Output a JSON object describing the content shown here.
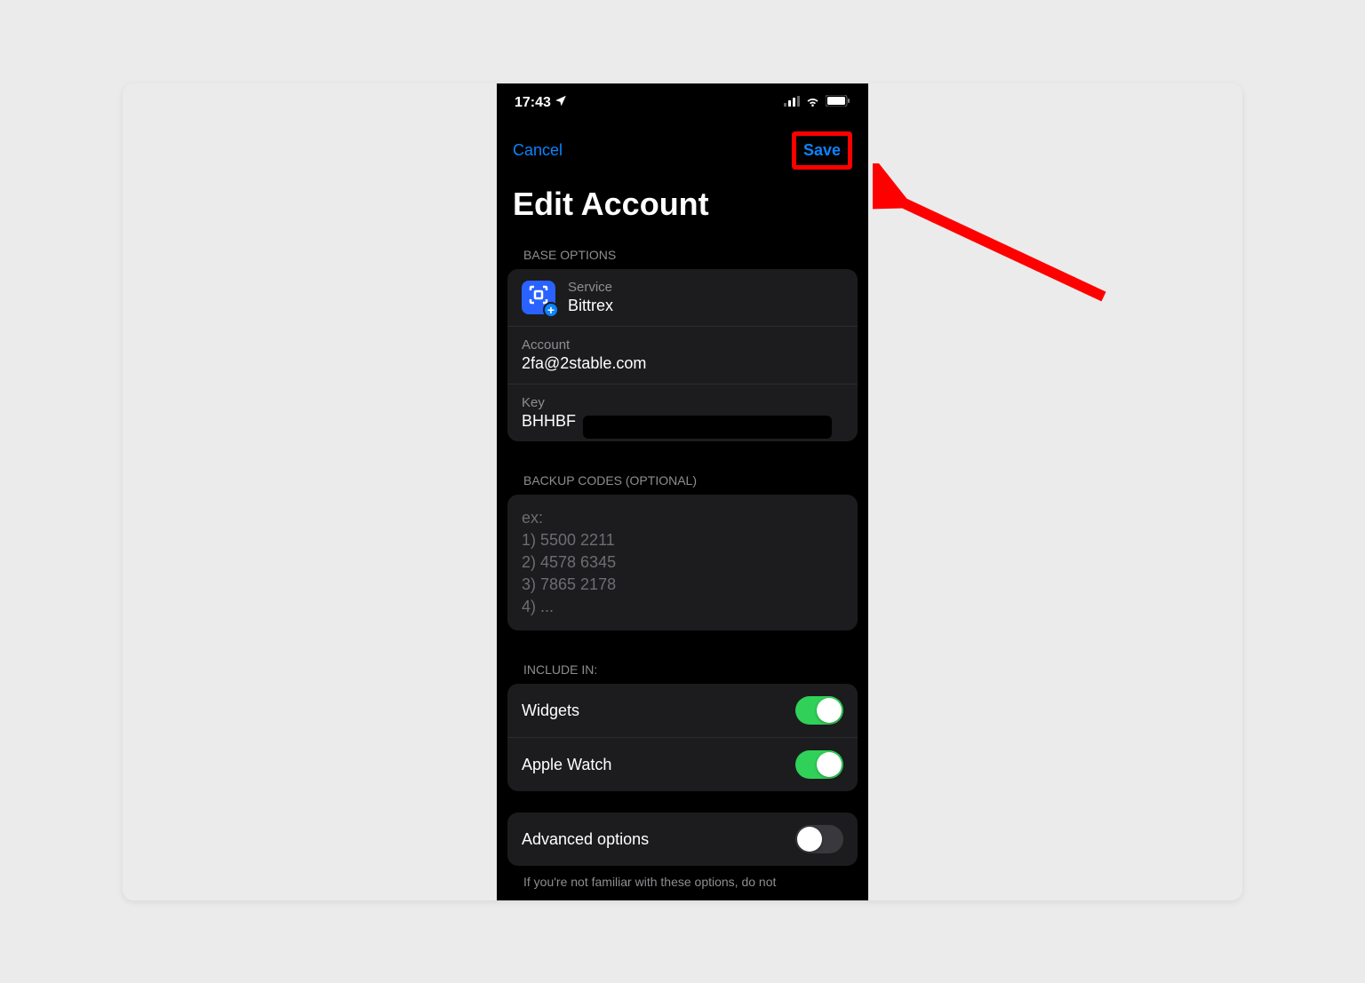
{
  "statusBar": {
    "time": "17:43"
  },
  "nav": {
    "cancel": "Cancel",
    "save": "Save"
  },
  "title": "Edit Account",
  "sections": {
    "baseOptions": {
      "header": "BASE OPTIONS",
      "service": {
        "label": "Service",
        "value": "Bittrex"
      },
      "account": {
        "label": "Account",
        "value": "2fa@2stable.com"
      },
      "key": {
        "label": "Key",
        "value": "BHHBF"
      }
    },
    "backupCodes": {
      "header": "BACKUP CODES (OPTIONAL)",
      "placeholder": "ex:\n1) 5500 2211\n2) 4578 6345\n3) 7865 2178\n4) ..."
    },
    "includeIn": {
      "header": "INCLUDE IN:",
      "widgets": {
        "label": "Widgets",
        "enabled": true
      },
      "appleWatch": {
        "label": "Apple Watch",
        "enabled": true
      }
    },
    "advanced": {
      "label": "Advanced options",
      "enabled": false,
      "footer": "If you're not familiar with these options, do not"
    }
  }
}
